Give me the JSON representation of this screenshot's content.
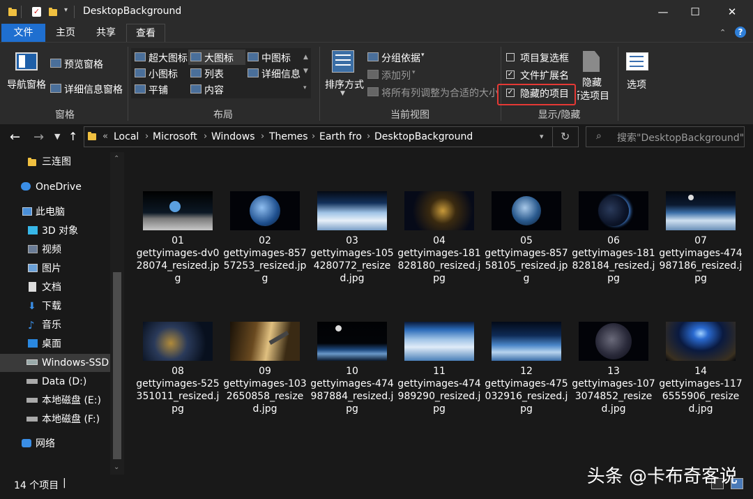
{
  "window": {
    "title": "DesktopBackground",
    "minimize_glyph": "—",
    "maximize_glyph": "☐",
    "close_glyph": "✕"
  },
  "ribbon_tabs": [
    "文件",
    "主页",
    "共享",
    "查看"
  ],
  "ribbon": {
    "panes": {
      "nav_pane": "导航窗格",
      "preview_pane": "预览窗格",
      "details_pane": "详细信息窗格",
      "group_label": "窗格"
    },
    "layout": {
      "items": [
        "超大图标",
        "大图标",
        "中图标",
        "小图标",
        "列表",
        "详细信息",
        "平铺",
        "内容"
      ],
      "group_label": "布局"
    },
    "current_view": {
      "sort_by": "排序方式",
      "group_by": "分组依据",
      "add_columns": "添加列",
      "size_all_columns": "将所有列调整为合适的大小",
      "group_label": "当前视图"
    },
    "show_hide": {
      "item_checkboxes": "项目复选框",
      "file_extensions": "文件扩展名",
      "hidden_items": "隐藏的项目",
      "hide_selected_line1": "隐藏",
      "hide_selected_line2": "所选项目",
      "group_label": "显示/隐藏",
      "item_checkboxes_checked": false,
      "file_extensions_checked": true,
      "hidden_items_checked": true
    },
    "options": "选项",
    "highlight_color": "#e53935"
  },
  "address": {
    "prefix": "«",
    "crumbs": [
      "Local",
      "Microsoft",
      "Windows",
      "Themes",
      "Earth fro",
      "DesktopBackground"
    ],
    "search_placeholder": "搜索\"DesktopBackground\""
  },
  "nav": {
    "items": [
      "三连图",
      "OneDrive",
      "此电脑",
      "3D 对象",
      "视频",
      "图片",
      "文档",
      "下载",
      "音乐",
      "桌面",
      "Windows-SSD (",
      "Data (D:)",
      "本地磁盘 (E:)",
      "本地磁盘 (F:)",
      "网络"
    ]
  },
  "files": [
    {
      "num": "01",
      "name": "gettyimages-dv028074_resized.jpg"
    },
    {
      "num": "02",
      "name": "gettyimages-85757253_resized.jpg"
    },
    {
      "num": "03",
      "name": "gettyimages-1054280772_resized.jpg"
    },
    {
      "num": "04",
      "name": "gettyimages-181828180_resized.jpg"
    },
    {
      "num": "05",
      "name": "gettyimages-85758105_resized.jpg"
    },
    {
      "num": "06",
      "name": "gettyimages-181828184_resized.jpg"
    },
    {
      "num": "07",
      "name": "gettyimages-474987186_resized.jpg"
    },
    {
      "num": "08",
      "name": "gettyimages-525351011_resized.jpg"
    },
    {
      "num": "09",
      "name": "gettyimages-1032650858_resized.jpg"
    },
    {
      "num": "10",
      "name": "gettyimages-474987884_resized.jpg"
    },
    {
      "num": "11",
      "name": "gettyimages-474989290_resized.jpg"
    },
    {
      "num": "12",
      "name": "gettyimages-475032916_resized.jpg"
    },
    {
      "num": "13",
      "name": "gettyimages-1073074852_resized.jpg"
    },
    {
      "num": "14",
      "name": "gettyimages-1176555906_resized.jpg"
    }
  ],
  "status": {
    "count": "14 个项目",
    "cursor": "|"
  },
  "watermark": "头条 @卡布奇客说"
}
